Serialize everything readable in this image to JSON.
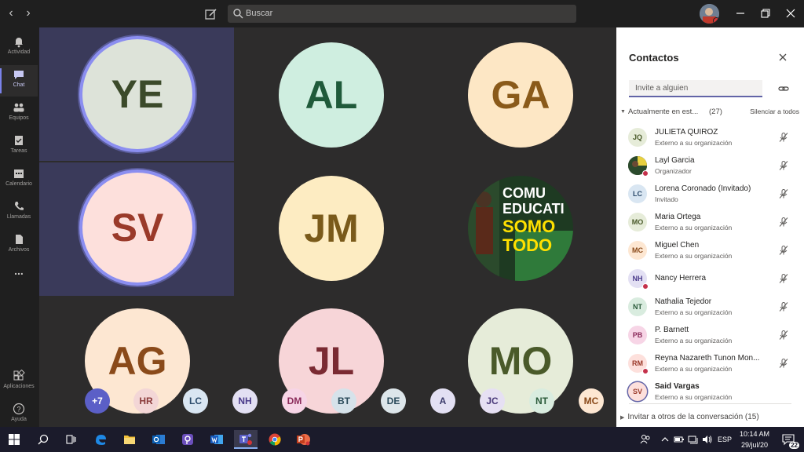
{
  "titlebar": {
    "search_placeholder": "Buscar"
  },
  "rail": {
    "items": [
      {
        "label": "Actividad",
        "icon": "bell-icon"
      },
      {
        "label": "Chat",
        "icon": "chat-icon"
      },
      {
        "label": "Equipos",
        "icon": "teams-icon"
      },
      {
        "label": "Tareas",
        "icon": "tasks-icon"
      },
      {
        "label": "Calendario",
        "icon": "calendar-icon"
      },
      {
        "label": "Llamadas",
        "icon": "phone-icon"
      },
      {
        "label": "Archivos",
        "icon": "files-icon"
      }
    ],
    "more": "...",
    "apps_label": "Aplicaciones",
    "help_label": "Ayuda"
  },
  "stage": {
    "tiles": [
      {
        "initials": "YE",
        "bg": "#dde3d9",
        "fg": "#3b4a2a",
        "speaking": true
      },
      {
        "initials": "AL",
        "bg": "#cfeee0",
        "fg": "#1f5a3a",
        "speaking": false
      },
      {
        "initials": "GA",
        "bg": "#fde7c5",
        "fg": "#8a5a1a",
        "speaking": false
      },
      {
        "initials": "SV",
        "bg": "#fde0dc",
        "fg": "#9a3a2a",
        "speaking": true
      },
      {
        "initials": "JM",
        "bg": "#fdecc2",
        "fg": "#7a5a1a",
        "speaking": false
      },
      {
        "initials": "",
        "photo": true,
        "speaking": false
      },
      {
        "initials": "AG",
        "bg": "#fde7d2",
        "fg": "#8a4a1a",
        "speaking": false
      },
      {
        "initials": "JL",
        "bg": "#f7d5d8",
        "fg": "#7a2a32",
        "speaking": false
      },
      {
        "initials": "MO",
        "bg": "#e6ecd9",
        "fg": "#4a5a2a",
        "speaking": false
      }
    ],
    "photo_caption_lines": [
      "COMU",
      "EDUCATI",
      "SOMO",
      "TODO"
    ],
    "strip": [
      {
        "initials": "+7",
        "bg": "#5b5fc7",
        "fg": "#ffffff"
      },
      {
        "initials": "HR",
        "bg": "#f3d6d6",
        "fg": "#8a3a3a"
      },
      {
        "initials": "LC",
        "bg": "#d9e6f2",
        "fg": "#2a4a6a"
      },
      {
        "initials": "NH",
        "bg": "#e3e0f3",
        "fg": "#4a3a8a"
      },
      {
        "initials": "DM",
        "bg": "#f7d5e6",
        "fg": "#8a2a5a"
      },
      {
        "initials": "BT",
        "bg": "#d6e2ea",
        "fg": "#2a4a5a"
      },
      {
        "initials": "DE",
        "bg": "#dde6ea",
        "fg": "#2a4a5a"
      },
      {
        "initials": "A",
        "bg": "#e3e0f3",
        "fg": "#3a3a6a"
      },
      {
        "initials": "JC",
        "bg": "#e6e0f3",
        "fg": "#4a3a7a"
      },
      {
        "initials": "NT",
        "bg": "#d9ecdf",
        "fg": "#2a5a3a"
      },
      {
        "initials": "MC",
        "bg": "#fde7d2",
        "fg": "#8a4a1a"
      }
    ]
  },
  "panel": {
    "title": "Contactos",
    "invite_placeholder": "Invite a alguien",
    "section_name": "Actualmente en est...",
    "section_count": "(27)",
    "mute_all": "Silenciar a todos",
    "people": [
      {
        "initials": "JQ",
        "name": "JULIETA QUIROZ",
        "role": "Externo a su organización",
        "bg": "#e6ecd9",
        "fg": "#4a5a2a",
        "dot": false
      },
      {
        "initials": "",
        "name": "Layl Garcia",
        "role": "Organizador",
        "photo": true,
        "dot": true
      },
      {
        "initials": "LC",
        "name": "Lorena Coronado (Invitado)",
        "role": "Invitado",
        "bg": "#d9e6f2",
        "fg": "#2a4a6a",
        "dot": false
      },
      {
        "initials": "MO",
        "name": "Maria Ortega",
        "role": "Externo a su organización",
        "bg": "#e6ecd9",
        "fg": "#4a5a2a",
        "dot": false
      },
      {
        "initials": "MC",
        "name": "Miguel Chen",
        "role": "Externo a su organización",
        "bg": "#fde7d2",
        "fg": "#8a4a1a",
        "dot": false
      },
      {
        "initials": "NH",
        "name": "Nancy Herrera",
        "role": "",
        "bg": "#e3e0f3",
        "fg": "#4a3a8a",
        "dot": true
      },
      {
        "initials": "NT",
        "name": "Nathalia Tejedor",
        "role": "Externo a su organización",
        "bg": "#d9ecdf",
        "fg": "#2a5a3a",
        "dot": false
      },
      {
        "initials": "PB",
        "name": "P. Barnett",
        "role": "Externo a su organización",
        "bg": "#f7d5e6",
        "fg": "#8a2a5a",
        "dot": false
      },
      {
        "initials": "RM",
        "name": "Reyna Nazareth Tunon Mon...",
        "role": "Externo a su organización",
        "bg": "#fde0dc",
        "fg": "#9a3a2a",
        "dot": true
      },
      {
        "initials": "SV",
        "name": "Said Vargas",
        "role": "Externo a su organización",
        "bg": "#fde0dc",
        "fg": "#9a3a2a",
        "dot": false,
        "bold": true,
        "speaking": true
      }
    ],
    "invite_others": "Invitar a otros de la conversación (15)"
  },
  "taskbar": {
    "lang": "ESP",
    "time": "10:14 AM",
    "date": "29/jul/20",
    "notif_count": "22"
  }
}
